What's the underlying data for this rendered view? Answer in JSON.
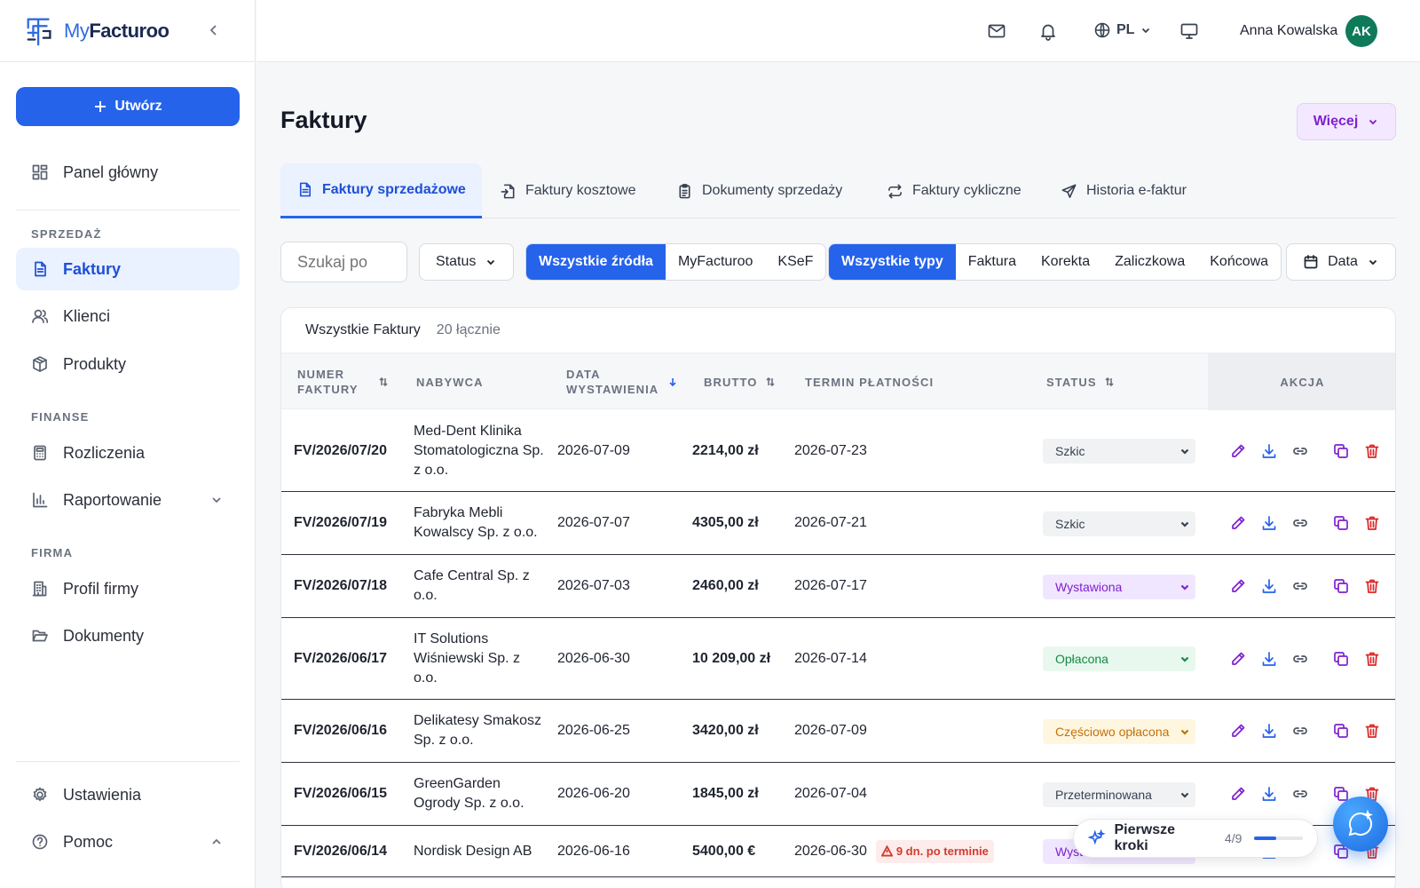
{
  "app": {
    "logo_my": "My",
    "logo_name": "Facturoo"
  },
  "sidebar": {
    "create_label": "Utwórz",
    "dashboard": "Panel główny",
    "sections": {
      "sales": "SPRZEDAŻ",
      "finance": "FINANSE",
      "company": "FIRMA"
    },
    "items": {
      "invoices": "Faktury",
      "clients": "Klienci",
      "products": "Produkty",
      "settlements": "Rozliczenia",
      "reporting": "Raportowanie",
      "company_profile": "Profil firmy",
      "documents": "Dokumenty",
      "settings": "Ustawienia",
      "help": "Pomoc"
    }
  },
  "topbar": {
    "lang": "PL",
    "user_name": "Anna Kowalska",
    "user_initials": "AK"
  },
  "page": {
    "title": "Faktury",
    "more_label": "Więcej"
  },
  "tabs": [
    {
      "label": "Faktury sprzedażowe",
      "icon": "document-icon",
      "active": true
    },
    {
      "label": "Faktury kosztowe",
      "icon": "document-import-icon"
    },
    {
      "label": "Dokumenty sprzedaży",
      "icon": "clipboard-icon"
    },
    {
      "label": "Faktury cykliczne",
      "icon": "repeat-icon"
    },
    {
      "label": "Historia e-faktur",
      "icon": "send-icon"
    }
  ],
  "filters": {
    "search_placeholder": "Szukaj po",
    "status_label": "Status",
    "sources": [
      "Wszystkie źródła",
      "MyFacturoo",
      "KSeF"
    ],
    "types": [
      "Wszystkie typy",
      "Faktura",
      "Korekta",
      "Zaliczkowa",
      "Końcowa"
    ],
    "date_label": "Data"
  },
  "table": {
    "title": "Wszystkie Faktury",
    "count": "20 łącznie",
    "columns": {
      "number_1": "NUMER",
      "number_2": "FAKTURY",
      "buyer": "NABYWCA",
      "date_1": "DATA",
      "date_2": "WYSTAWIENIA",
      "gross": "BRUTTO",
      "due": "TERMIN PŁATNOŚCI",
      "status": "STATUS",
      "action": "AKCJA"
    },
    "rows": [
      {
        "number": "FV/2026/07/20",
        "buyer": "Med-Dent Klinika Stomatologiczna Sp. z o.o.",
        "date": "2026-07-09",
        "gross": "2214,00 zł",
        "due": "2026-07-23",
        "status": "Szkic"
      },
      {
        "number": "FV/2026/07/19",
        "buyer": "Fabryka Mebli Kowalscy Sp. z o.o.",
        "date": "2026-07-07",
        "gross": "4305,00 zł",
        "due": "2026-07-21",
        "status": "Szkic"
      },
      {
        "number": "FV/2026/07/18",
        "buyer": "Cafe Central Sp. z o.o.",
        "date": "2026-07-03",
        "gross": "2460,00 zł",
        "due": "2026-07-17",
        "status": "Wystawiona"
      },
      {
        "number": "FV/2026/06/17",
        "buyer": "IT Solutions Wiśniewski Sp. z o.o.",
        "date": "2026-06-30",
        "gross": "10 209,00 zł",
        "due": "2026-07-14",
        "status": "Opłacona"
      },
      {
        "number": "FV/2026/06/16",
        "buyer": "Delikatesy Smakosz Sp. z o.o.",
        "date": "2026-06-25",
        "gross": "3420,00 zł",
        "due": "2026-07-09",
        "status": "Częściowo opłacona"
      },
      {
        "number": "FV/2026/06/15",
        "buyer": "GreenGarden Ogrody Sp. z o.o.",
        "date": "2026-06-20",
        "gross": "1845,00 zł",
        "due": "2026-07-04",
        "status": "Przeterminowana"
      },
      {
        "number": "FV/2026/06/14",
        "buyer": "Nordisk Design AB",
        "date": "2026-06-16",
        "gross": "5400,00 €",
        "due": "2026-06-30",
        "status": "Wystawiona",
        "overdue_note": "9 dn. po terminie"
      }
    ]
  },
  "onboarding": {
    "label": "Pierwsze kroki",
    "progress_text": "4/9",
    "progress_fraction": 0.444
  },
  "colors": {
    "primary": "#2563eb",
    "accent_purple": "#7e22ce",
    "danger": "#dc2626",
    "success": "#168a46"
  }
}
